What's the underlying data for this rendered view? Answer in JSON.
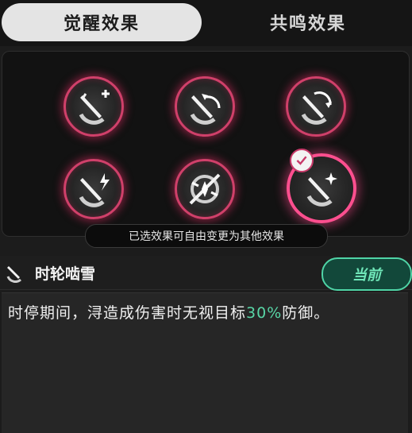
{
  "tabs": {
    "active_label": "觉醒效果",
    "inactive_label": "共鸣效果"
  },
  "effects_grid": {
    "nodes": [
      {
        "icon": "sword-plus-icon",
        "selected": false
      },
      {
        "icon": "sword-arrow-icon",
        "selected": false
      },
      {
        "icon": "sword-cycle-icon",
        "selected": false
      },
      {
        "icon": "sword-lightning-icon",
        "selected": false
      },
      {
        "icon": "crossed-blades-icon",
        "selected": false
      },
      {
        "icon": "sword-spark-icon",
        "selected": true
      }
    ],
    "hint": "已选效果可自由变更为其他效果"
  },
  "effect": {
    "icon": "sword-icon",
    "name": "时轮啮雪",
    "current_label": "当前",
    "description_prefix": "时停期间，浔造成伤害时无视目标",
    "description_highlight": "30%",
    "description_suffix": "防御。"
  },
  "colors": {
    "ring": "#d0406a",
    "selected_ring": "#ff4f8f",
    "accent_green": "#58d6a6"
  }
}
